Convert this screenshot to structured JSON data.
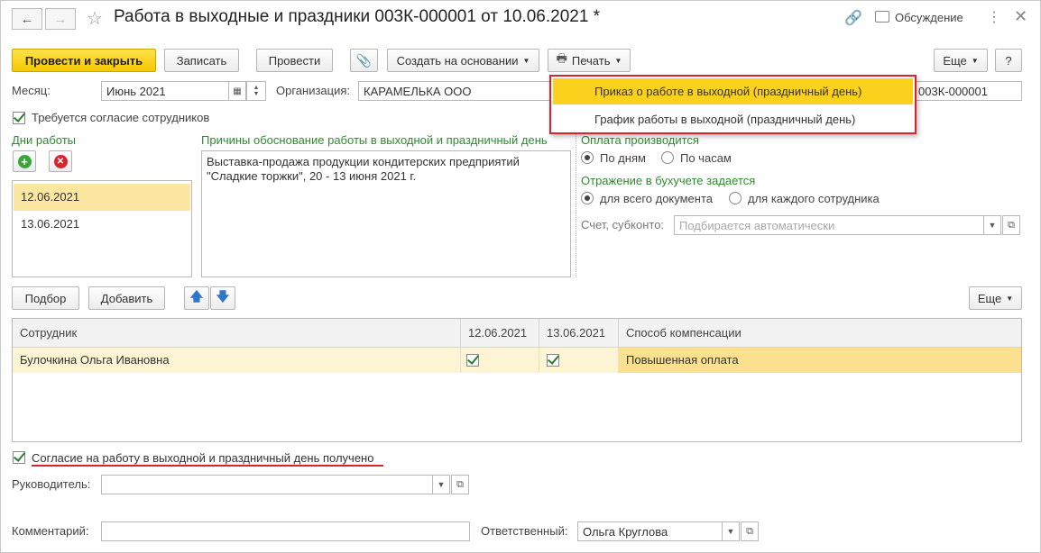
{
  "window": {
    "title": "Работа в выходные и праздники 003К-000001 от 10.06.2021 *",
    "discussion_label": "Обсуждение"
  },
  "toolbar": {
    "post_close": "Провести и закрыть",
    "write": "Записать",
    "post": "Провести",
    "create_based": "Создать на основании",
    "print": "Печать",
    "more": "Еще",
    "help": "?"
  },
  "print_menu": {
    "items": [
      "Приказ о работе в выходной (праздничный день)",
      "График работы в выходной (праздничный день)"
    ]
  },
  "header": {
    "month_label": "Месяц:",
    "month_value": "Июнь 2021",
    "org_label": "Организация:",
    "org_value": "КАРАМЕЛЬКА ООО",
    "number_value": "003К-000001",
    "consent_required": "Требуется согласие сотрудников"
  },
  "work_days": {
    "label": "Дни работы",
    "items": [
      "12.06.2021",
      "13.06.2021"
    ]
  },
  "reasons": {
    "label": "Причины обоснование работы в выходной и праздничный день",
    "text_line1": "Выставка-продажа продукции кондитерских предприятий",
    "text_line2": "\"Сладкие торжки\", 20 - 13 июня 2021 г."
  },
  "payment": {
    "label": "Оплата производится",
    "by_days": "По дням",
    "by_hours": "По часам"
  },
  "accounting": {
    "label": "Отражение в бухучете задается",
    "whole_doc": "для всего документа",
    "each_employee": "для каждого сотрудника",
    "account_label": "Счет, субконто:",
    "account_placeholder": "Подбирается автоматически"
  },
  "table_toolbar": {
    "select": "Подбор",
    "add": "Добавить",
    "more": "Еще"
  },
  "employees": {
    "columns": [
      "Сотрудник",
      "12.06.2021",
      "13.06.2021",
      "Способ компенсации"
    ],
    "rows": [
      {
        "name": "Булочкина Ольга Ивановна",
        "day1": true,
        "day2": true,
        "compensation": "Повышенная оплата"
      }
    ]
  },
  "footer": {
    "consent_received": "Согласие на работу в выходной и праздничный день получено",
    "manager_label": "Руководитель:",
    "comment_label": "Комментарий:",
    "responsible_label": "Ответственный:",
    "responsible_value": "Ольга Круглова"
  },
  "colors": {
    "accent_yellow": "#f5c800",
    "highlight_red": "#d8242a",
    "label_green": "#2e8b2e"
  }
}
